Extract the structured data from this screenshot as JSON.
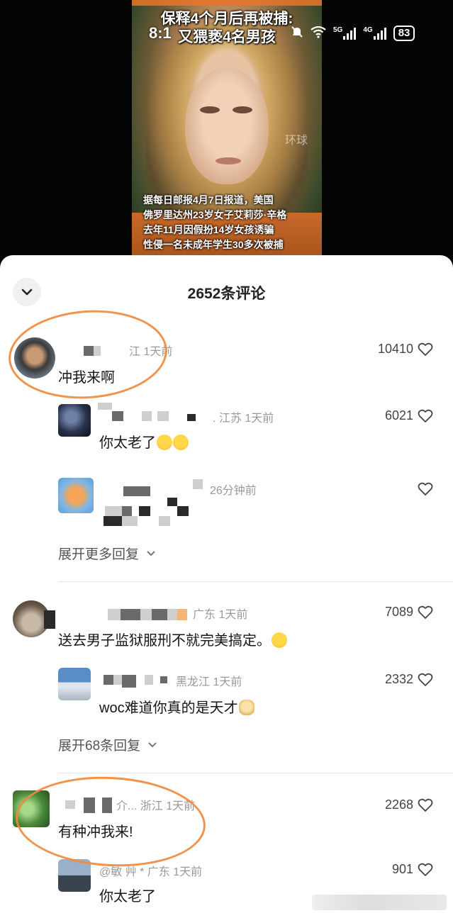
{
  "video": {
    "headline_line1": "保释4个月后再被捕:",
    "headline_line2": "又猥亵4名男孩",
    "overlay_time": "8:1",
    "watermark": "环球",
    "caption_lines": [
      "据每日邮报4月7日报道，美国",
      "佛罗里达州23岁女子艾莉莎·辛格",
      "去年11月因假扮14岁女孩诱骗",
      "性侵一名未成年学生30多次被捕"
    ]
  },
  "status_bar": {
    "net1": "5G",
    "net2": "4G",
    "battery": "83",
    "icons": [
      "alarm-icon",
      "mute-icon",
      "wifi-icon",
      "signal-icon",
      "battery-icon"
    ]
  },
  "sheet": {
    "title": "2652条评论",
    "comments": [
      {
        "meta": "江 1天前",
        "text": "冲我来啊",
        "likes": "10410",
        "replies": [
          {
            "meta": ". 江苏 1天前",
            "text": "你太老了",
            "likes": "6021"
          },
          {
            "meta": "26分钟前",
            "text": "",
            "likes": ""
          }
        ],
        "expand": "展开更多回复"
      },
      {
        "meta": "广东 1天前",
        "text": "送去男子监狱服刑不就完美搞定。",
        "likes": "7089",
        "replies": [
          {
            "meta": "黑龙江 1天前",
            "text": "woc难道你真的是天才",
            "likes": "2332"
          }
        ],
        "expand": "展开68条回复"
      },
      {
        "meta": "介... 浙江 1天前",
        "text": "有种冲我来!",
        "likes": "2268",
        "replies": [
          {
            "meta": "@敏 艸 * 广东 1天前",
            "text": "你太老了",
            "likes": "901"
          }
        ]
      }
    ]
  },
  "colors": {
    "annotation_circle": "#f08a3c",
    "sheet_bg": "#ffffff",
    "text_primary": "#161616",
    "text_meta": "#999999"
  }
}
